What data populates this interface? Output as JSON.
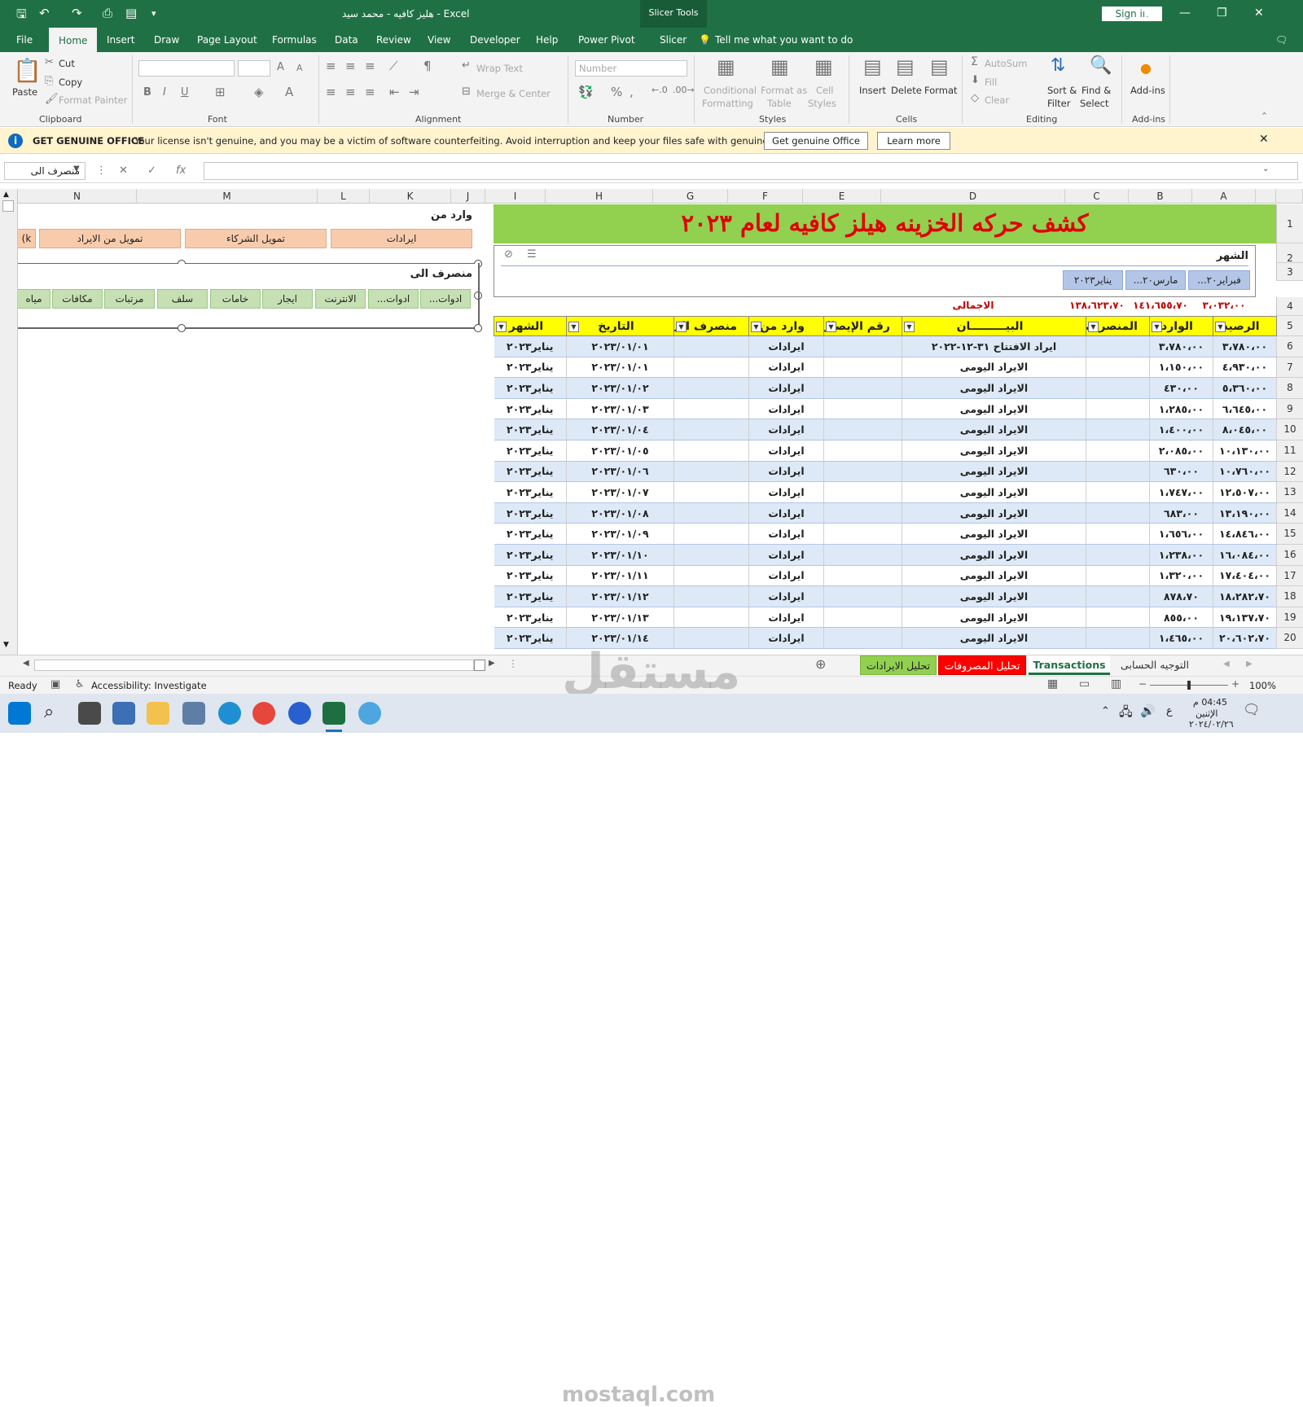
{
  "window": {
    "title": "هليز كافيه - محمد سيد  -  Excel",
    "context_tab": "Slicer Tools",
    "signin": "Sign in"
  },
  "menu": {
    "tabs": [
      "File",
      "Home",
      "Insert",
      "Draw",
      "Page Layout",
      "Formulas",
      "Data",
      "Review",
      "View",
      "Developer",
      "Help",
      "Power Pivot",
      "Slicer"
    ],
    "tell_me": "Tell me what you want to do"
  },
  "ribbon": {
    "clipboard": {
      "paste": "Paste",
      "cut": "Cut",
      "copy": "Copy",
      "format_painter": "Format Painter",
      "label": "Clipboard"
    },
    "font": {
      "label": "Font"
    },
    "alignment": {
      "wrap": "Wrap Text",
      "merge": "Merge & Center",
      "label": "Alignment"
    },
    "number": {
      "format": "Number",
      "label": "Number"
    },
    "styles": {
      "conditional": "Conditional",
      "formatting": "Formatting",
      "format_as": "Format as",
      "table": "Table",
      "cell": "Cell",
      "styles": "Styles",
      "label": "Styles"
    },
    "cells": {
      "insert": "Insert",
      "delete": "Delete",
      "format": "Format",
      "label": "Cells"
    },
    "editing": {
      "autosum": "AutoSum",
      "fill": "Fill",
      "clear": "Clear",
      "sort": "Sort &",
      "filter": "Filter",
      "find": "Find &",
      "select": "Select",
      "label": "Editing"
    },
    "addins": {
      "addins": "Add-ins",
      "label": "Add-ins"
    }
  },
  "warning": {
    "title": "GET GENUINE OFFICE",
    "message": "Your license isn't genuine, and you may be a victim of software counterfeiting. Avoid interruption and keep your files safe with genuine Office today.",
    "btn_genuine": "Get genuine Office",
    "btn_learn": "Learn more"
  },
  "formula_bar": {
    "name_box": "منصرف الى",
    "fx": "fx"
  },
  "columns": {
    "right": [
      "A",
      "B",
      "C",
      "D",
      "E",
      "F",
      "G",
      "H",
      "I"
    ],
    "left": [
      "J",
      "K",
      "L",
      "M",
      "N"
    ]
  },
  "rows": [
    "1",
    "2",
    "3",
    "4",
    "5",
    "6",
    "7",
    "8",
    "9",
    "10",
    "11",
    "12",
    "13",
    "14",
    "15",
    "16",
    "17",
    "18",
    "19",
    "20"
  ],
  "sheet_title": "كشف حركه الخزينه هيلز كافيه لعام ٢٠٢٣",
  "month_slicer": {
    "title": "الشهر",
    "items": [
      "فبراير٢٠...",
      "مارس٢٠...",
      "يناير٢٠٢٣"
    ]
  },
  "income_slicer": {
    "title": "وارد من",
    "items": [
      "ايرادات",
      "تمويل الشركاء",
      "تمويل من الايراد",
      "k)"
    ]
  },
  "expense_slicer": {
    "title": "منصرف الى",
    "items": [
      "ادوات...",
      "ادوات...",
      "الانترنت",
      "ايجار",
      "خامات",
      "سلف",
      "مرتبات",
      "مكافات",
      "مياه"
    ]
  },
  "totals": {
    "balance": "٣،٠٣٢،٠٠",
    "income": "١٤١،٦٥٥،٧٠",
    "expense": "١٣٨،٦٢٣،٧٠",
    "label": "الاجمالى"
  },
  "table": {
    "headers": [
      "الرصيد",
      "الوارد",
      "المنصرف",
      "البيـــــــــان",
      "رقم الإيصال",
      "وارد من",
      "منصرف الى",
      "التاريخ",
      "الشهر"
    ],
    "rows": [
      [
        "٣،٧٨٠،٠٠",
        "٣،٧٨٠،٠٠",
        "",
        "ايراد الافتتاح ٣١-١٢-٢٠٢٢",
        "",
        "ايرادات",
        "",
        "٢٠٢٣/٠١/٠١",
        "يناير٢٠٢٣"
      ],
      [
        "٤،٩٣٠،٠٠",
        "١،١٥٠،٠٠",
        "",
        "الايراد اليومى",
        "",
        "ايرادات",
        "",
        "٢٠٢٣/٠١/٠١",
        "يناير٢٠٢٣"
      ],
      [
        "٥،٣٦٠،٠٠",
        "٤٣٠،٠٠",
        "",
        "الايراد اليومى",
        "",
        "ايرادات",
        "",
        "٢٠٢٣/٠١/٠٢",
        "يناير٢٠٢٣"
      ],
      [
        "٦،٦٤٥،٠٠",
        "١،٢٨٥،٠٠",
        "",
        "الايراد اليومى",
        "",
        "ايرادات",
        "",
        "٢٠٢٣/٠١/٠٣",
        "يناير٢٠٢٣"
      ],
      [
        "٨،٠٤٥،٠٠",
        "١،٤٠٠،٠٠",
        "",
        "الايراد اليومى",
        "",
        "ايرادات",
        "",
        "٢٠٢٣/٠١/٠٤",
        "يناير٢٠٢٣"
      ],
      [
        "١٠،١٣٠،٠٠",
        "٢،٠٨٥،٠٠",
        "",
        "الايراد اليومى",
        "",
        "ايرادات",
        "",
        "٢٠٢٣/٠١/٠٥",
        "يناير٢٠٢٣"
      ],
      [
        "١٠،٧٦٠،٠٠",
        "٦٣٠،٠٠",
        "",
        "الايراد اليومى",
        "",
        "ايرادات",
        "",
        "٢٠٢٣/٠١/٠٦",
        "يناير٢٠٢٣"
      ],
      [
        "١٢،٥٠٧،٠٠",
        "١،٧٤٧،٠٠",
        "",
        "الايراد اليومى",
        "",
        "ايرادات",
        "",
        "٢٠٢٣/٠١/٠٧",
        "يناير٢٠٢٣"
      ],
      [
        "١٣،١٩٠،٠٠",
        "٦٨٣،٠٠",
        "",
        "الايراد اليومى",
        "",
        "ايرادات",
        "",
        "٢٠٢٣/٠١/٠٨",
        "يناير٢٠٢٣"
      ],
      [
        "١٤،٨٤٦،٠٠",
        "١،٦٥٦،٠٠",
        "",
        "الايراد اليومى",
        "",
        "ايرادات",
        "",
        "٢٠٢٣/٠١/٠٩",
        "يناير٢٠٢٣"
      ],
      [
        "١٦،٠٨٤،٠٠",
        "١،٢٣٨،٠٠",
        "",
        "الايراد اليومى",
        "",
        "ايرادات",
        "",
        "٢٠٢٣/٠١/١٠",
        "يناير٢٠٢٣"
      ],
      [
        "١٧،٤٠٤،٠٠",
        "١،٣٢٠،٠٠",
        "",
        "الايراد اليومى",
        "",
        "ايرادات",
        "",
        "٢٠٢٣/٠١/١١",
        "يناير٢٠٢٣"
      ],
      [
        "١٨،٢٨٢،٧٠",
        "٨٧٨،٧٠",
        "",
        "الايراد اليومى",
        "",
        "ايرادات",
        "",
        "٢٠٢٣/٠١/١٢",
        "يناير٢٠٢٣"
      ],
      [
        "١٩،١٣٧،٧٠",
        "٨٥٥،٠٠",
        "",
        "الايراد اليومى",
        "",
        "ايرادات",
        "",
        "٢٠٢٣/٠١/١٣",
        "يناير٢٠٢٣"
      ],
      [
        "٢٠،٦٠٢،٧٠",
        "١،٤٦٥،٠٠",
        "",
        "الايراد اليومى",
        "",
        "ايرادات",
        "",
        "٢٠٢٣/٠١/١٤",
        "يناير٢٠٢٣"
      ]
    ]
  },
  "sheet_tabs": [
    "التوجيه الحسابى",
    "Transactions",
    "تحليل المصروفات",
    "تحليل الايرادات"
  ],
  "sheet_tab_colors": {
    "income": "#92d050",
    "expense": "#ff0000",
    "active": "#ffffff"
  },
  "status": {
    "ready": "Ready",
    "accessibility": "Accessibility: Investigate",
    "zoom": "100%"
  },
  "taskbar": {
    "time": "04:45 م",
    "day": "الإثنين",
    "date": "٢٠٢٤/٠٢/٢٦",
    "lang": "ع"
  },
  "watermark": {
    "arabic": "مستقل",
    "latin": "mostaql.com"
  }
}
